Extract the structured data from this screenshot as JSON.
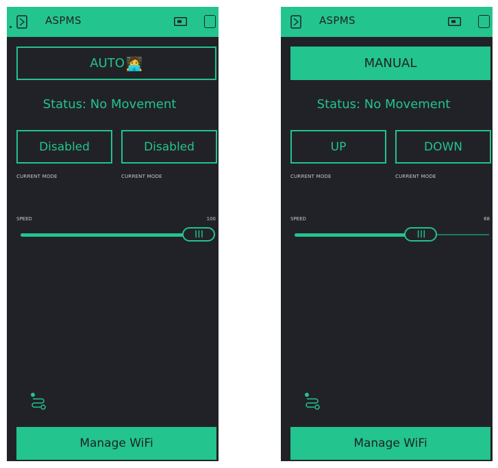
{
  "colors": {
    "accent": "#23c48e",
    "background": "#212227",
    "label": "#c9c9c9"
  },
  "screens": [
    {
      "title": "ASPMS",
      "mode_button": {
        "label": "AUTO",
        "emoji": "🧑‍💻",
        "filled": false
      },
      "status": "Status: No Movement",
      "buttons": [
        {
          "label": "Disabled",
          "caption": "CURRENT MODE"
        },
        {
          "label": "Disabled",
          "caption": "CURRENT MODE"
        }
      ],
      "speed": {
        "label": "SPEED",
        "value": 100,
        "value_text": "100",
        "min": 0,
        "max": 100
      },
      "footer_button": "Manage WiFi"
    },
    {
      "title": "ASPMS",
      "mode_button": {
        "label": "MANUAL",
        "emoji": "",
        "filled": true
      },
      "status": "Status: No Movement",
      "buttons": [
        {
          "label": "UP",
          "caption": "CURRENT MODE"
        },
        {
          "label": "DOWN",
          "caption": "CURRENT MODE"
        }
      ],
      "speed": {
        "label": "SPEED",
        "value": 68,
        "value_text": "68",
        "min": 0,
        "max": 100
      },
      "footer_button": "Manage WiFi"
    }
  ],
  "icons": {
    "header_left": "device-frame-icon",
    "header_device": "device-tile-icon",
    "header_square": "square-icon",
    "route": "route-icon",
    "slider_knob": "knob-grip-icon"
  }
}
